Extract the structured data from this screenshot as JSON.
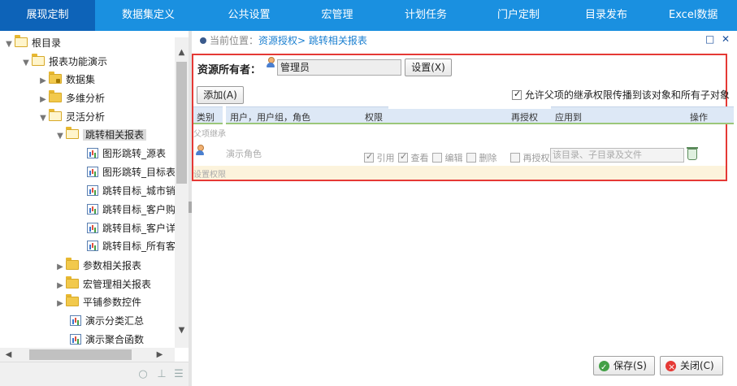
{
  "nav": {
    "items": [
      "展现定制",
      "数据集定义",
      "公共设置",
      "宏管理",
      "计划任务",
      "门户定制",
      "目录发布",
      "Excel数据"
    ]
  },
  "tree": {
    "items": [
      {
        "label": "根目录",
        "icon": "folder-open-icon"
      },
      {
        "label": "报表功能演示",
        "icon": "folder-open-icon"
      },
      {
        "label": "数据集",
        "icon": "locked-folder-icon"
      },
      {
        "label": "多维分析",
        "icon": "folder-icon"
      },
      {
        "label": "灵活分析",
        "icon": "folder-open-icon"
      },
      {
        "label": "跳转相关报表",
        "icon": "folder-open-icon"
      },
      {
        "label": "图形跳转_源表",
        "icon": "report-icon"
      },
      {
        "label": "图形跳转_目标表",
        "icon": "report-icon"
      },
      {
        "label": "跳转目标_城市销",
        "icon": "report-icon"
      },
      {
        "label": "跳转目标_客户购",
        "icon": "report-icon"
      },
      {
        "label": "跳转目标_客户详",
        "icon": "report-icon"
      },
      {
        "label": "跳转目标_所有客",
        "icon": "report-icon"
      },
      {
        "label": "参数相关报表",
        "icon": "folder-icon"
      },
      {
        "label": "宏管理相关报表",
        "icon": "folder-icon"
      },
      {
        "label": "平铺参数控件",
        "icon": "folder-icon"
      },
      {
        "label": "演示分类汇总",
        "icon": "report-icon"
      },
      {
        "label": "演示聚合函数",
        "icon": "report-icon"
      }
    ]
  },
  "breadcrumb": {
    "prefix": "当前位置：",
    "path": "资源授权> 跳转相关报表"
  },
  "owner": {
    "label": "资源所有者：",
    "value": "管理员",
    "set_button": "设置(X)"
  },
  "add_button": "添加(A)",
  "inherit": {
    "checked": true,
    "label": "允许父项的继承权限传播到该对象和所有子对象"
  },
  "table": {
    "headers": [
      "类别",
      "用户，用户组，角色",
      "权限",
      "再授权",
      "应用到",
      "操作"
    ],
    "section_inherit": "父项继承",
    "row": {
      "name": "演示角色",
      "permissions": [
        {
          "label": "引用",
          "checked": true
        },
        {
          "label": "查看",
          "checked": true
        },
        {
          "label": "编辑",
          "checked": false
        },
        {
          "label": "删除",
          "checked": false
        }
      ],
      "regrant": {
        "label": "再授权",
        "checked": false
      },
      "apply_to": "该目录、子目录及文件"
    },
    "section_set": "设置权限"
  },
  "footer": {
    "save": "保存(S)",
    "close": "关闭(C)"
  }
}
